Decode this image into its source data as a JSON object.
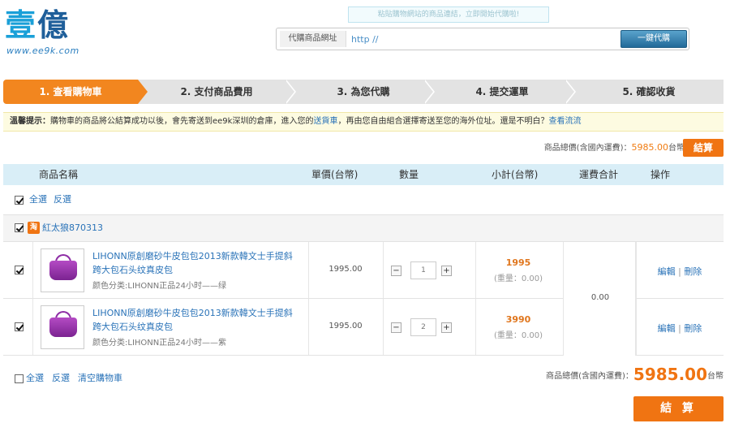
{
  "header": {
    "logo_text_1": "壹",
    "logo_text_2": "億",
    "logo_url": "www.ee9k.com",
    "hint": "粘貼購物網站的商品連結，立即開始代購啦!",
    "url_label": "代購商品網址",
    "url_placeholder": "http //",
    "url_button": "一鍵代購"
  },
  "steps": [
    {
      "label": "1. 查看購物車",
      "active": true
    },
    {
      "label": "2. 支付商品費用",
      "active": false
    },
    {
      "label": "3. 為您代購",
      "active": false
    },
    {
      "label": "4. 提交運單",
      "active": false
    },
    {
      "label": "5. 確認收貨",
      "active": false
    }
  ],
  "tip": {
    "title": "溫馨提示：",
    "text_1": "購物車的商品將公結算成功以後，會先寄送到ee9k深圳的倉庫，進入您的",
    "link_1": "送貨車",
    "text_2": "，再由您自由組合選擇寄送至您的海外位址。還是不明白？",
    "link_2": "查看流流"
  },
  "top_total": {
    "label": "商品總價(含國內運費)：",
    "amount": "5985.00",
    "currency": "台幣",
    "checkout": "結算"
  },
  "table_header": {
    "name": "商品名稱",
    "unit_price": "單價(台幣)",
    "quantity": "數量",
    "subtotal": "小計(台幣)",
    "shipping": "運費合計",
    "ops": "操作"
  },
  "select": {
    "all": "全選",
    "invert": "反選"
  },
  "shop": {
    "icon": "淘",
    "name": "紅太狼870313"
  },
  "items": [
    {
      "name": "LIHONN原創磨砂牛皮包包2013新款韓文士手提斜跨大包石头纹真皮包",
      "attr": "颜色分类:LIHONN正品24小时——绿",
      "price": "1995.00",
      "qty": "1",
      "subtotal": "1995",
      "weight": "(重量：0.00)",
      "edit": "編輯",
      "sep": "|",
      "delete": "刪除"
    },
    {
      "name": "LIHONN原創磨砂牛皮包包2013新款韓文士手提斜跨大包石头纹真皮包",
      "attr": "颜色分类:LIHONN正品24小时——紫",
      "price": "1995.00",
      "qty": "2",
      "subtotal": "3990",
      "weight": "(重量：0.00)",
      "edit": "編輯",
      "sep": "|",
      "delete": "刪除"
    }
  ],
  "shipping_total": "0.00",
  "bottom": {
    "select_all": "全選",
    "invert": "反選",
    "clear": "清空購物車",
    "total_label": "商品總價(含國內運費)：",
    "total_amount": "5985.00",
    "currency": "台幣",
    "checkout": "結 算"
  },
  "colors": {
    "accent": "#f07412",
    "link": "#2a73b8",
    "header_bg": "#d9eef7"
  }
}
